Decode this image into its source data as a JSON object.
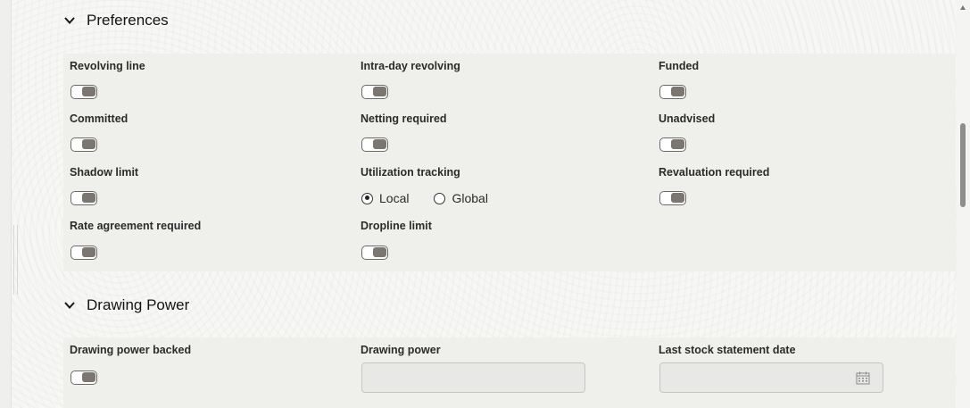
{
  "preferences": {
    "title": "Preferences",
    "fields": {
      "revolving_line": "Revolving line",
      "intra_day_revolving": "Intra-day revolving",
      "funded": "Funded",
      "committed": "Committed",
      "netting_required": "Netting required",
      "unadvised": "Unadvised",
      "shadow_limit": "Shadow limit",
      "utilization_tracking": "Utilization tracking",
      "revaluation_required": "Revaluation required",
      "rate_agreement_required": "Rate agreement required",
      "dropline_limit": "Dropline limit"
    },
    "utilization_options": {
      "local": "Local",
      "global": "Global",
      "selected": "Local"
    }
  },
  "drawing_power": {
    "title": "Drawing Power",
    "fields": {
      "drawing_power_backed": "Drawing power backed",
      "drawing_power": "Drawing power",
      "last_stock_statement_date": "Last stock statement date"
    },
    "drawing_power_value": "",
    "last_stock_statement_date_value": ""
  },
  "icons": {
    "section_toggle": "chevron-down-icon",
    "date_picker": "calendar-icon"
  },
  "colors": {
    "toggle_knob": "#7b7670",
    "panel_bg": "#efefec",
    "page_bg": "#f7f7f5"
  }
}
